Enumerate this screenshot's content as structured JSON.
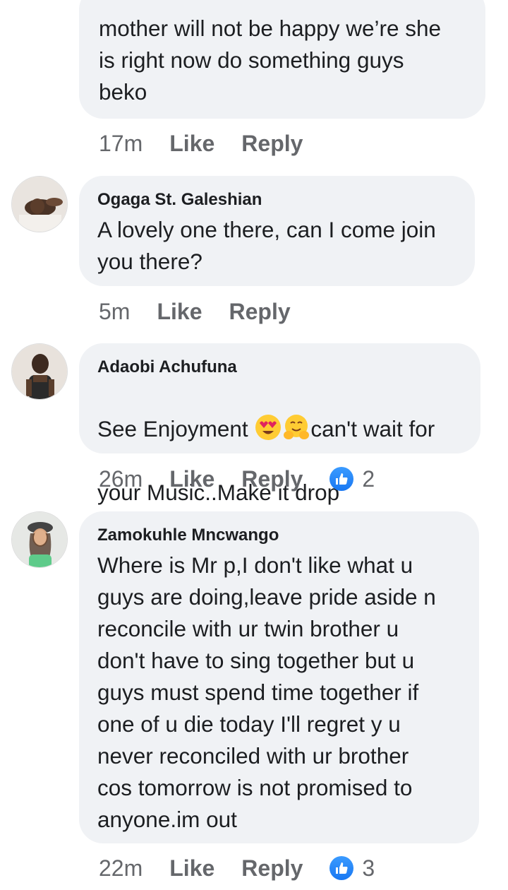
{
  "comments": [
    {
      "author": "",
      "text": "mother will not be happy we’re she\nis right now do something guys\nbeko",
      "time": "17m",
      "like_label": "Like",
      "reply_label": "Reply",
      "reaction_count": null
    },
    {
      "author": "Ogaga St. Galeshian",
      "text": "A lovely one there, can I come join\nyou there?",
      "time": "5m",
      "like_label": "Like",
      "reply_label": "Reply",
      "reaction_count": null
    },
    {
      "author": "Adaobi Achufuna",
      "text_before_emoji": "See Enjoyment ",
      "text_after_emoji": "can't wait for",
      "text_line2": "your Music..Make it drop",
      "emojis": [
        "heart-eyes-emoji",
        "hugging-emoji"
      ],
      "time": "26m",
      "like_label": "Like",
      "reply_label": "Reply",
      "reaction_count": "2"
    },
    {
      "author": "Zamokuhle Mncwango",
      "text": "Where is Mr p,I don't like what u\nguys are  doing,leave pride aside n\nreconcile with ur twin brother u\ndon't have to sing together but u\nguys must spend time together if\none of u die today I'll regret y u\nnever reconciled with ur brother\ncos tomorrow is not promised to\nanyone.im out",
      "time": "22m",
      "like_label": "Like",
      "reply_label": "Reply",
      "reaction_count": "3"
    }
  ],
  "colors": {
    "bubble_bg": "#f0f2f5",
    "meta_text": "#65676b",
    "like_blue": "#1877f2"
  }
}
